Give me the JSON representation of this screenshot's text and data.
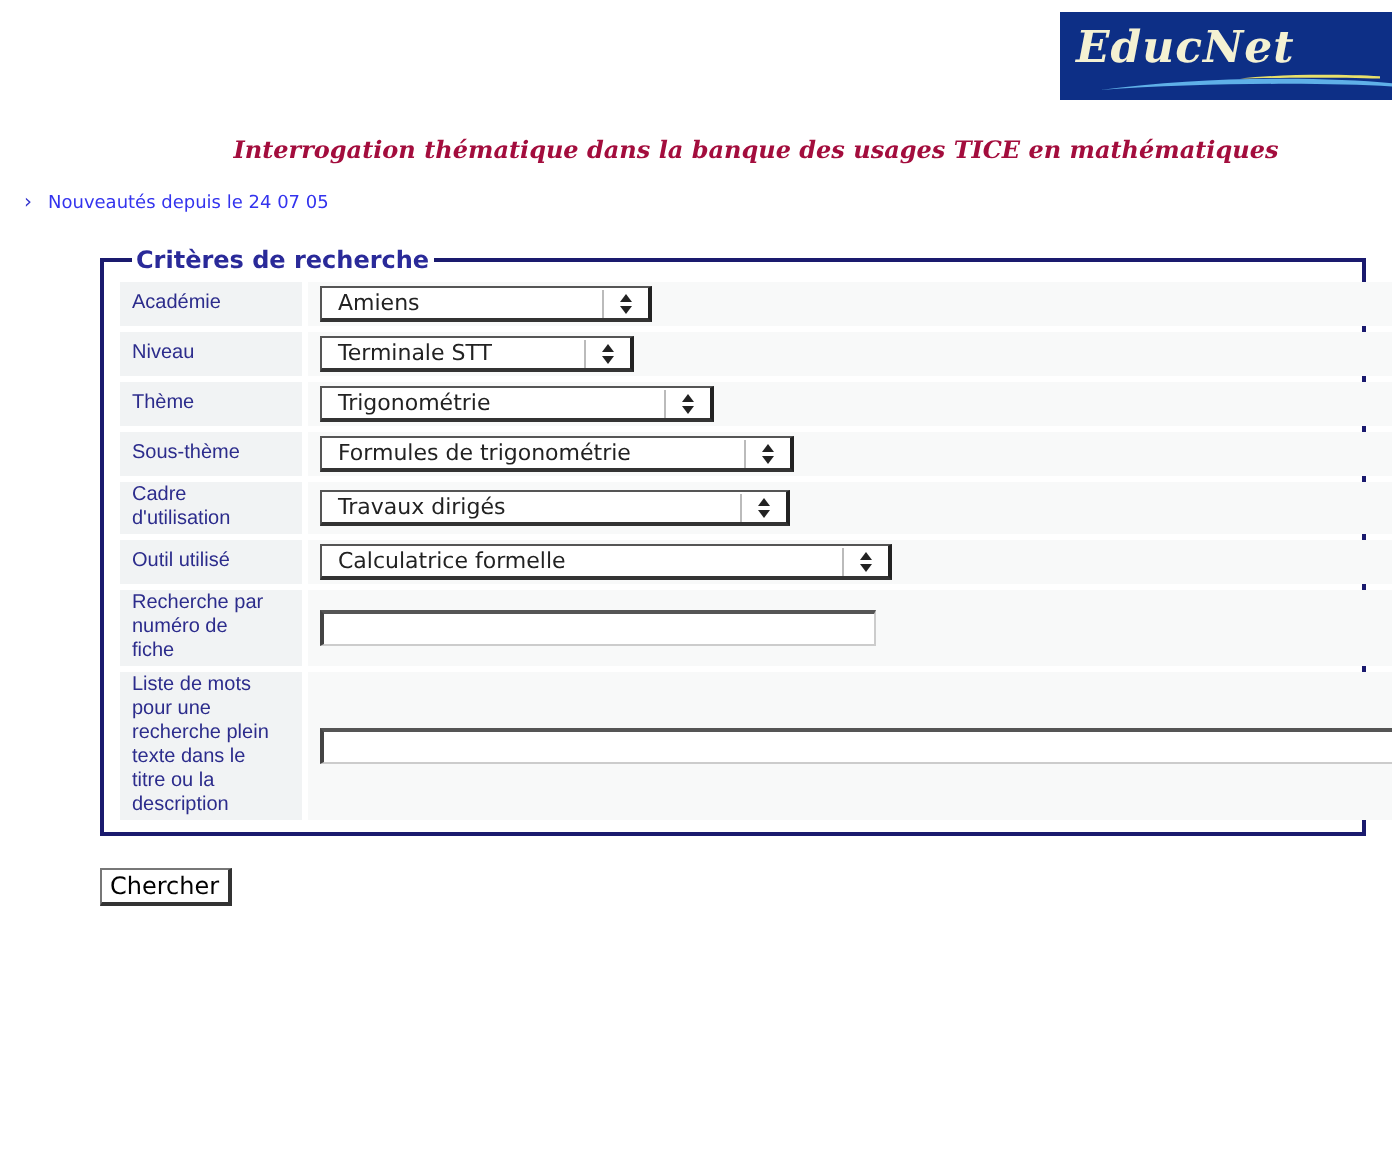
{
  "logo": {
    "text": "EducNet"
  },
  "title": "Interrogation thématique dans la banque des usages TICE en mathématiques",
  "news_link": {
    "bullet": "›",
    "label": "Nouveautés depuis le 24 07 05"
  },
  "criteria": {
    "legend": "Critères de recherche",
    "rows": [
      {
        "kind": "select",
        "label": "Académie",
        "value": "Amiens"
      },
      {
        "kind": "select",
        "label": "Niveau",
        "value": "Terminale STT"
      },
      {
        "kind": "select",
        "label": "Thème",
        "value": "Trigonométrie"
      },
      {
        "kind": "select",
        "label": "Sous-thème",
        "value": "Formules de trigonométrie"
      },
      {
        "kind": "select",
        "label": "Cadre d'utilisation",
        "value": "Travaux dirigés"
      },
      {
        "kind": "select",
        "label": "Outil utilisé",
        "value": "Calculatrice formelle"
      },
      {
        "kind": "text",
        "label": "Recherche par numéro de fiche"
      },
      {
        "kind": "text",
        "label": "Liste de mots pour une recherche plein texte dans le titre ou la description"
      }
    ]
  },
  "submit": "Chercher"
}
